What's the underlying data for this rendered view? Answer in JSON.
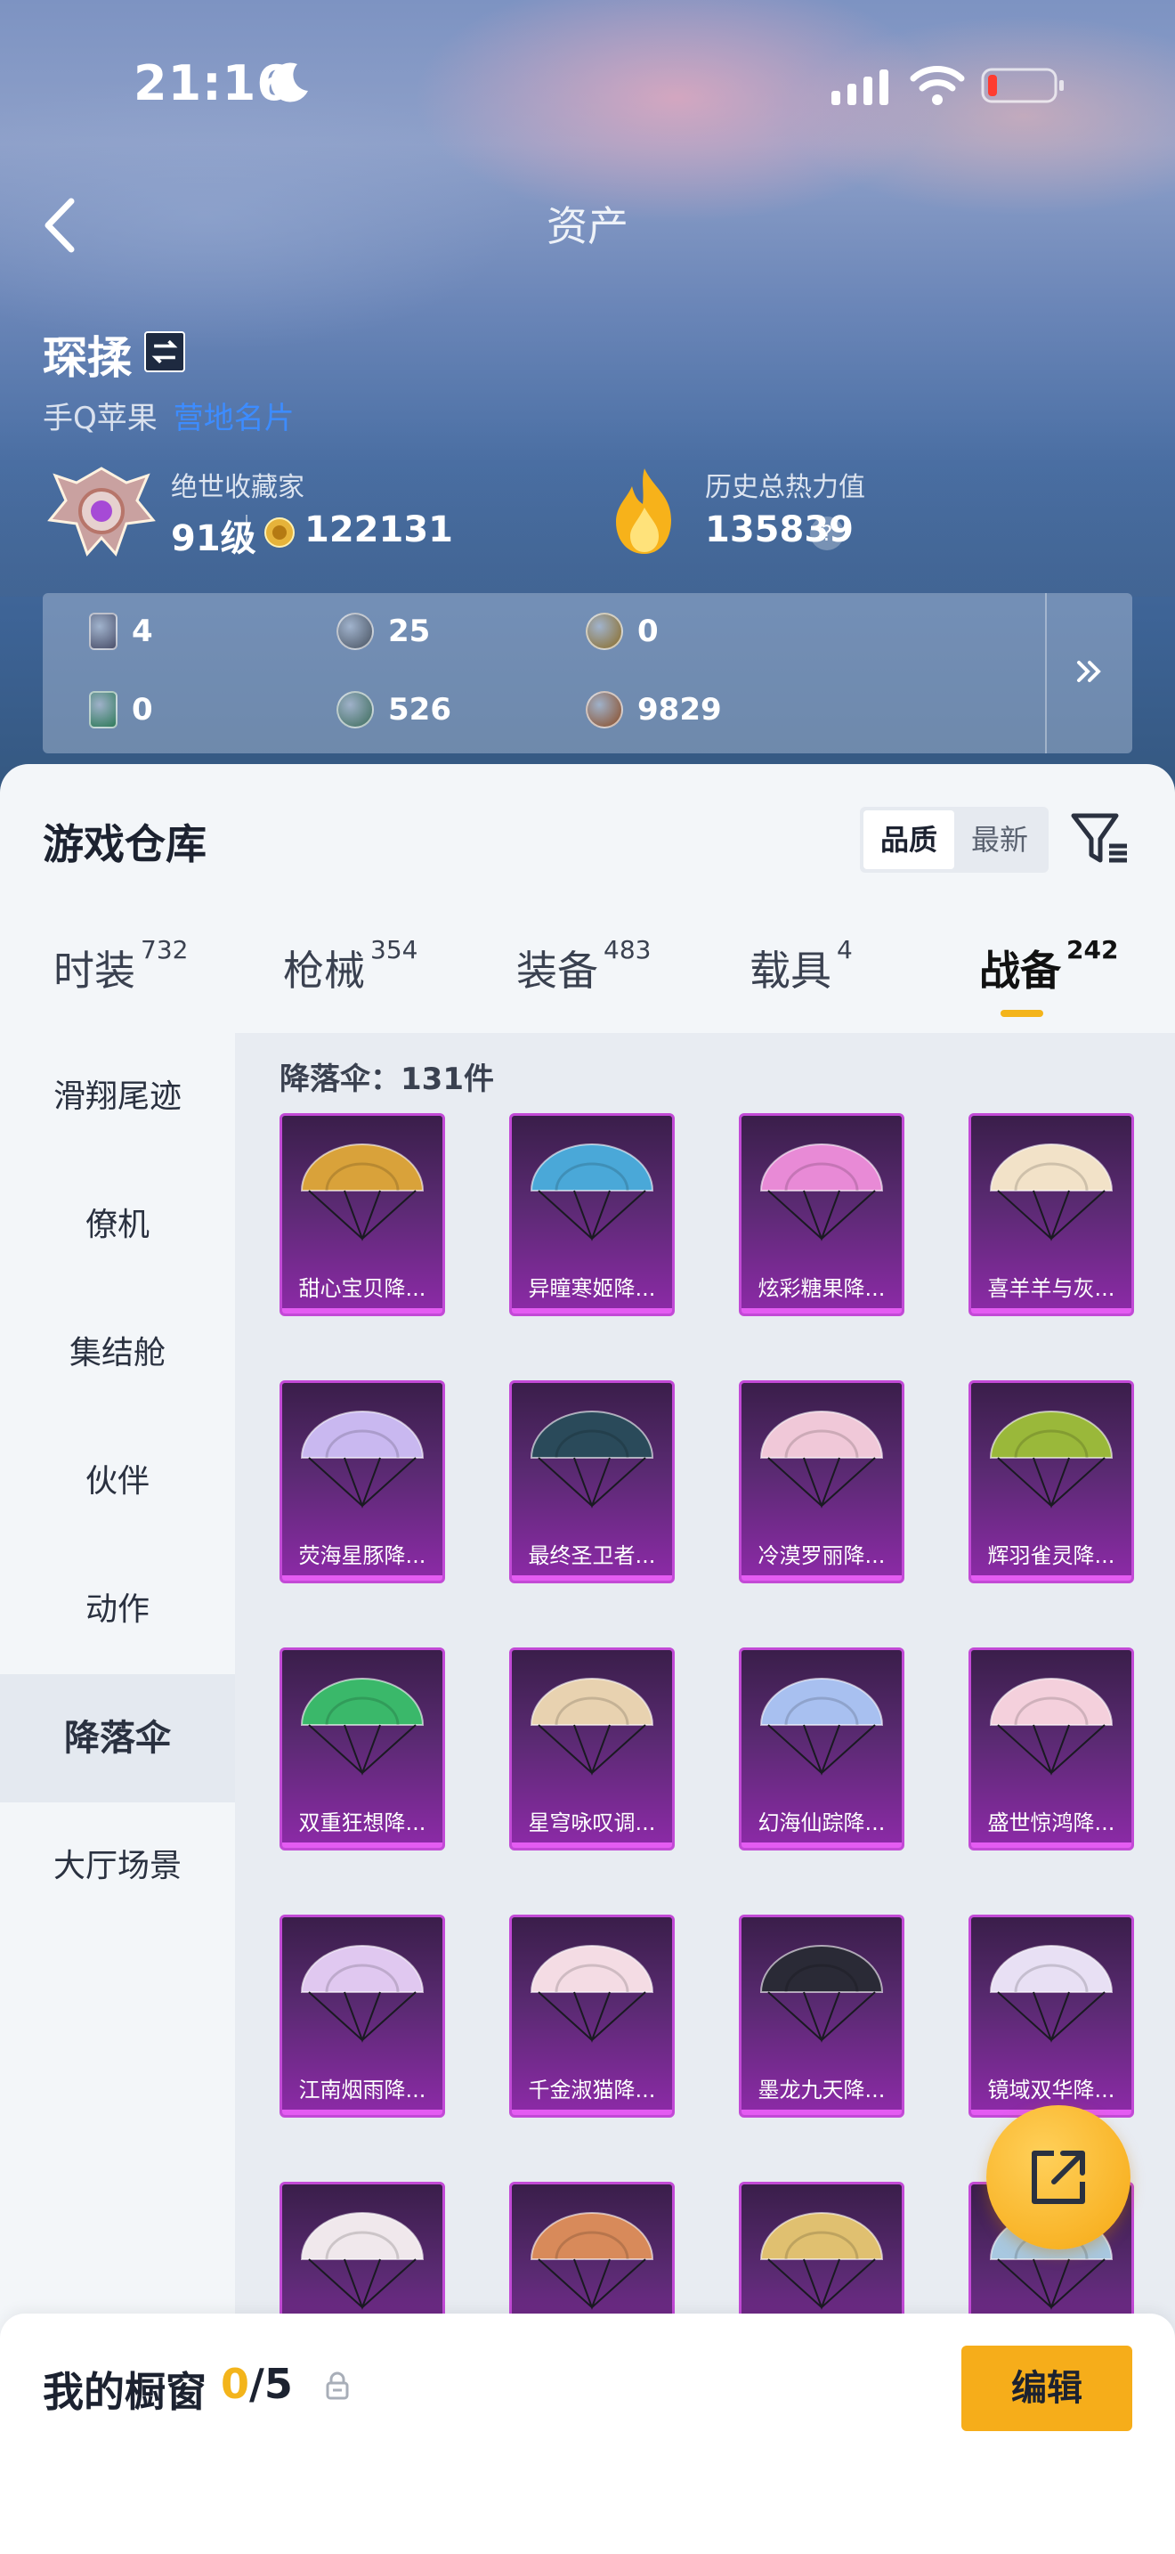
{
  "status": {
    "time": "21:16"
  },
  "nav": {
    "title": "资产"
  },
  "user": {
    "name": "琛揉",
    "account": "手Q苹果",
    "account_link": "营地名片"
  },
  "collector": {
    "title": "绝世收藏家",
    "level": "91级",
    "coins": "122131"
  },
  "heat": {
    "title": "历史总热力值",
    "value": "135839",
    "help": "?"
  },
  "currencies": [
    {
      "icon": "card-icon",
      "value": "4",
      "color": "#4a4f6a"
    },
    {
      "icon": "silver-coin-icon",
      "value": "25",
      "color": "#46505e"
    },
    {
      "icon": "gold-badge-icon",
      "value": "0",
      "color": "#8a6a22"
    },
    {
      "icon": "green-card-icon",
      "value": "0",
      "color": "#2f7a5a"
    },
    {
      "icon": "green-orb-icon",
      "value": "526",
      "color": "#3a6a58"
    },
    {
      "icon": "bronze-orb-icon",
      "value": "9829",
      "color": "#8a4a22"
    }
  ],
  "warehouse": {
    "title": "游戏仓库",
    "sort_quality": "品质",
    "sort_latest": "最新"
  },
  "tabs": [
    {
      "label": "时装",
      "count": "732"
    },
    {
      "label": "枪械",
      "count": "354"
    },
    {
      "label": "装备",
      "count": "483"
    },
    {
      "label": "载具",
      "count": "4"
    },
    {
      "label": "战备",
      "count": "242"
    }
  ],
  "sidebar": [
    {
      "label": "滑翔尾迹"
    },
    {
      "label": "僚机"
    },
    {
      "label": "集结舱"
    },
    {
      "label": "伙伴"
    },
    {
      "label": "动作"
    },
    {
      "label": "降落伞"
    },
    {
      "label": "大厅场景"
    }
  ],
  "content": {
    "title": "降落伞：131件",
    "items": [
      {
        "name": "甜心宝贝降...",
        "color": "#d9a23a"
      },
      {
        "name": "异瞳寒姬降...",
        "color": "#4aa8d8"
      },
      {
        "name": "炫彩糖果降...",
        "color": "#e88ad6"
      },
      {
        "name": "喜羊羊与灰...",
        "color": "#f2e2c8"
      },
      {
        "name": "荧海星豚降...",
        "color": "#c9b8f0"
      },
      {
        "name": "最终圣卫者...",
        "color": "#2a4a5a"
      },
      {
        "name": "冷漠罗丽降...",
        "color": "#f0c8d8"
      },
      {
        "name": "辉羽雀灵降...",
        "color": "#9ab83a"
      },
      {
        "name": "双重狂想降...",
        "color": "#3ab86a"
      },
      {
        "name": "星穹咏叹调...",
        "color": "#e8d2b0"
      },
      {
        "name": "幻海仙踪降...",
        "color": "#a8c0f0"
      },
      {
        "name": "盛世惊鸿降...",
        "color": "#f4d0dc"
      },
      {
        "name": "江南烟雨降...",
        "color": "#e0c8f0"
      },
      {
        "name": "千金淑猫降...",
        "color": "#f4dce4"
      },
      {
        "name": "墨龙九天降...",
        "color": "#2a2a36"
      },
      {
        "name": "镜域双华降...",
        "color": "#e8e0f4"
      },
      {
        "name": "",
        "color": "#f0e8ec"
      },
      {
        "name": "",
        "color": "#d88a5a"
      },
      {
        "name": "",
        "color": "#e0c070"
      },
      {
        "name": "",
        "color": "#a8c8e0"
      }
    ]
  },
  "showcase": {
    "label": "我的橱窗",
    "current": "0",
    "total": "/5",
    "edit": "编辑"
  }
}
